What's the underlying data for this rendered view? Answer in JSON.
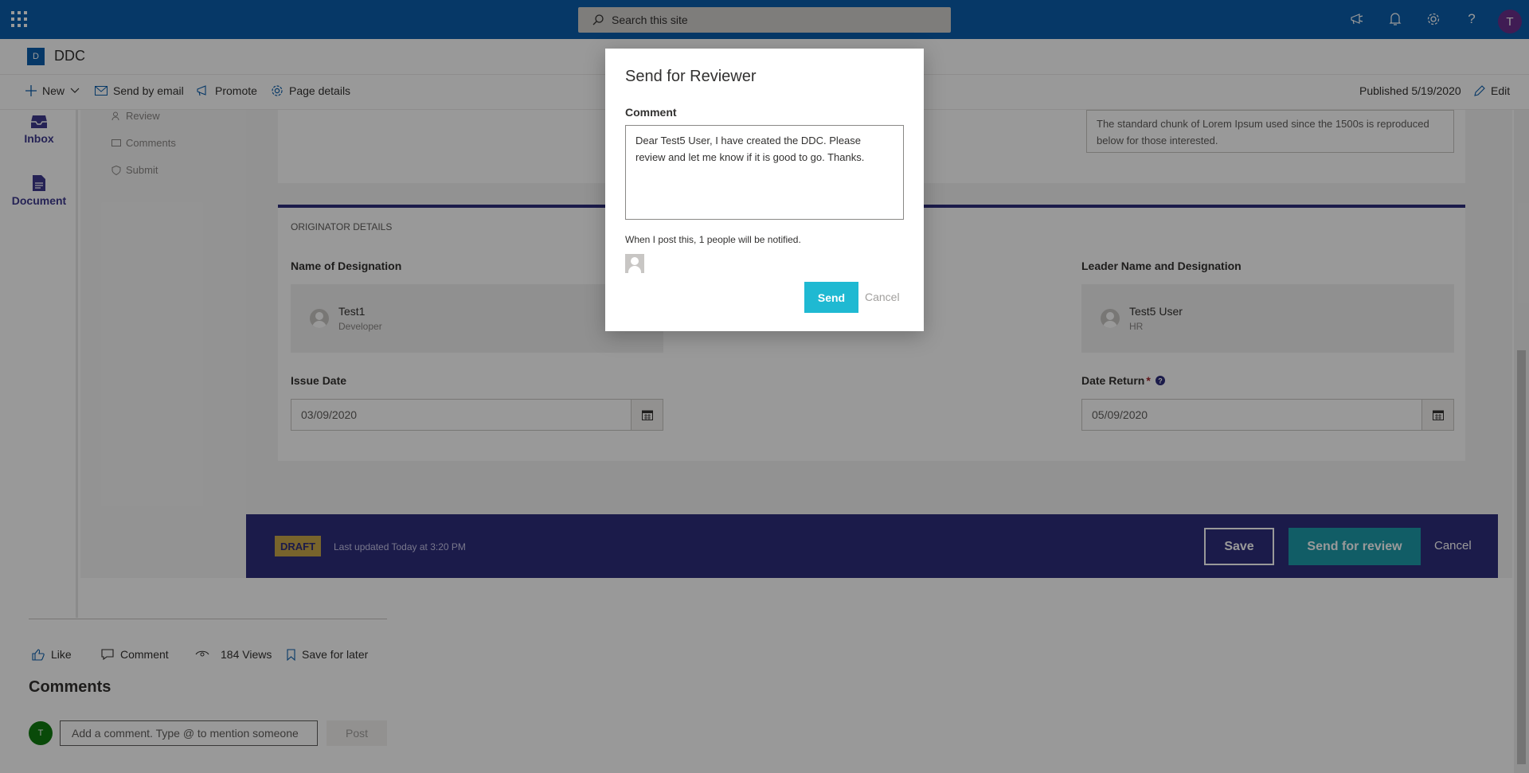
{
  "suite": {
    "search_placeholder": "Search this site",
    "user_initial": "T"
  },
  "site": {
    "logo_letter": "D",
    "name": "DDC"
  },
  "command_bar": {
    "new": "New",
    "send_by_email": "Send by email",
    "promote": "Promote",
    "page_details": "Page details",
    "published": "Published 5/19/2020",
    "edit": "Edit"
  },
  "left_rail": {
    "inbox": "Inbox",
    "document": "Document"
  },
  "sub_nav": {
    "review": "Review",
    "comments": "Comments",
    "submit": "Submit"
  },
  "top_card": {
    "textarea_text": "The standard chunk of Lorem Ipsum used since the 1500s is reproduced below for those interested."
  },
  "originator": {
    "section_title": "ORIGINATOR DETAILS",
    "name_label": "Name of Designation",
    "name_person": "Test1",
    "name_role": "Developer",
    "leader_label": "Leader Name and Designation",
    "leader_person": "Test5 User",
    "leader_role": "HR",
    "issue_label": "Issue Date",
    "issue_value": "03/09/2020",
    "return_label": "Date Return",
    "return_required": "*",
    "return_value": "05/09/2020"
  },
  "status_bar": {
    "badge": "DRAFT",
    "last_updated": "Last updated Today at 3:20 PM",
    "save": "Save",
    "send_for_review": "Send for review",
    "cancel": "Cancel"
  },
  "footer": {
    "like": "Like",
    "comment": "Comment",
    "views": "184 Views",
    "save_for_later": "Save for later",
    "comments_heading": "Comments",
    "avatar_initial": "T",
    "comment_placeholder": "Add a comment. Type @ to mention someone",
    "post": "Post"
  },
  "modal": {
    "title": "Send for Reviewer",
    "comment_label": "Comment",
    "comment_value": "Dear Test5 User, I have created the DDC. Please review and let me know if it is good to go. Thanks.",
    "notify_text": "When I post this, 1 people will be notified.",
    "send": "Send",
    "cancel": "Cancel"
  },
  "colors": {
    "suite_bar": "#0a5eac",
    "status_bar": "#2e2d7c",
    "send_button": "#1fb9d2",
    "draft_badge": "#c9a74a"
  }
}
